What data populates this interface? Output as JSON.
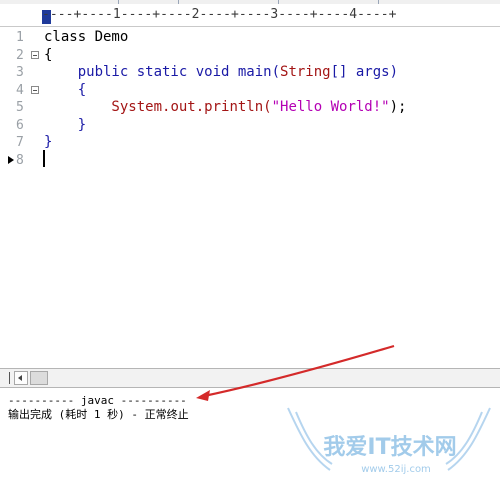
{
  "ruler": {
    "text": "----+----1----+----2----+----3----+----4----+"
  },
  "editor": {
    "lines": [
      {
        "num": "1",
        "parts": [
          {
            "text": "class Demo",
            "cls": ""
          }
        ]
      },
      {
        "num": "2",
        "parts": [
          {
            "text": "{",
            "cls": ""
          }
        ]
      },
      {
        "num": "3",
        "parts": [
          {
            "text": "    public static void main(",
            "cls": "kw"
          },
          {
            "text": "String",
            "cls": "cls"
          },
          {
            "text": "[] args)",
            "cls": "kw"
          }
        ]
      },
      {
        "num": "4",
        "parts": [
          {
            "text": "    {",
            "cls": "kw"
          }
        ]
      },
      {
        "num": "5",
        "parts": [
          {
            "text": "        System",
            "cls": "cls"
          },
          {
            "text": ".out.println(",
            "cls": "cls"
          },
          {
            "text": "\"Hello World!\"",
            "cls": "str"
          },
          {
            "text": ");",
            "cls": ""
          }
        ]
      },
      {
        "num": "6",
        "parts": [
          {
            "text": "    }",
            "cls": "kw"
          }
        ]
      },
      {
        "num": "7",
        "parts": [
          {
            "text": "}",
            "cls": "kw"
          }
        ]
      },
      {
        "num": "8",
        "parts": [
          {
            "text": "",
            "cls": ""
          }
        ]
      }
    ],
    "fold_lines": [
      "2",
      "4"
    ],
    "bookmark_line": "8"
  },
  "output": {
    "header": "---------- javac ----------",
    "status": "输出完成 (耗时 1 秒) - 正常终止"
  },
  "watermark": {
    "text": "我爱IT技术网",
    "url": "www.52ij.com"
  },
  "colors": {
    "keyword": "#1a1aa6",
    "class": "#a31515",
    "string": "#b400b4",
    "annotation_arrow": "#d42a2a"
  }
}
